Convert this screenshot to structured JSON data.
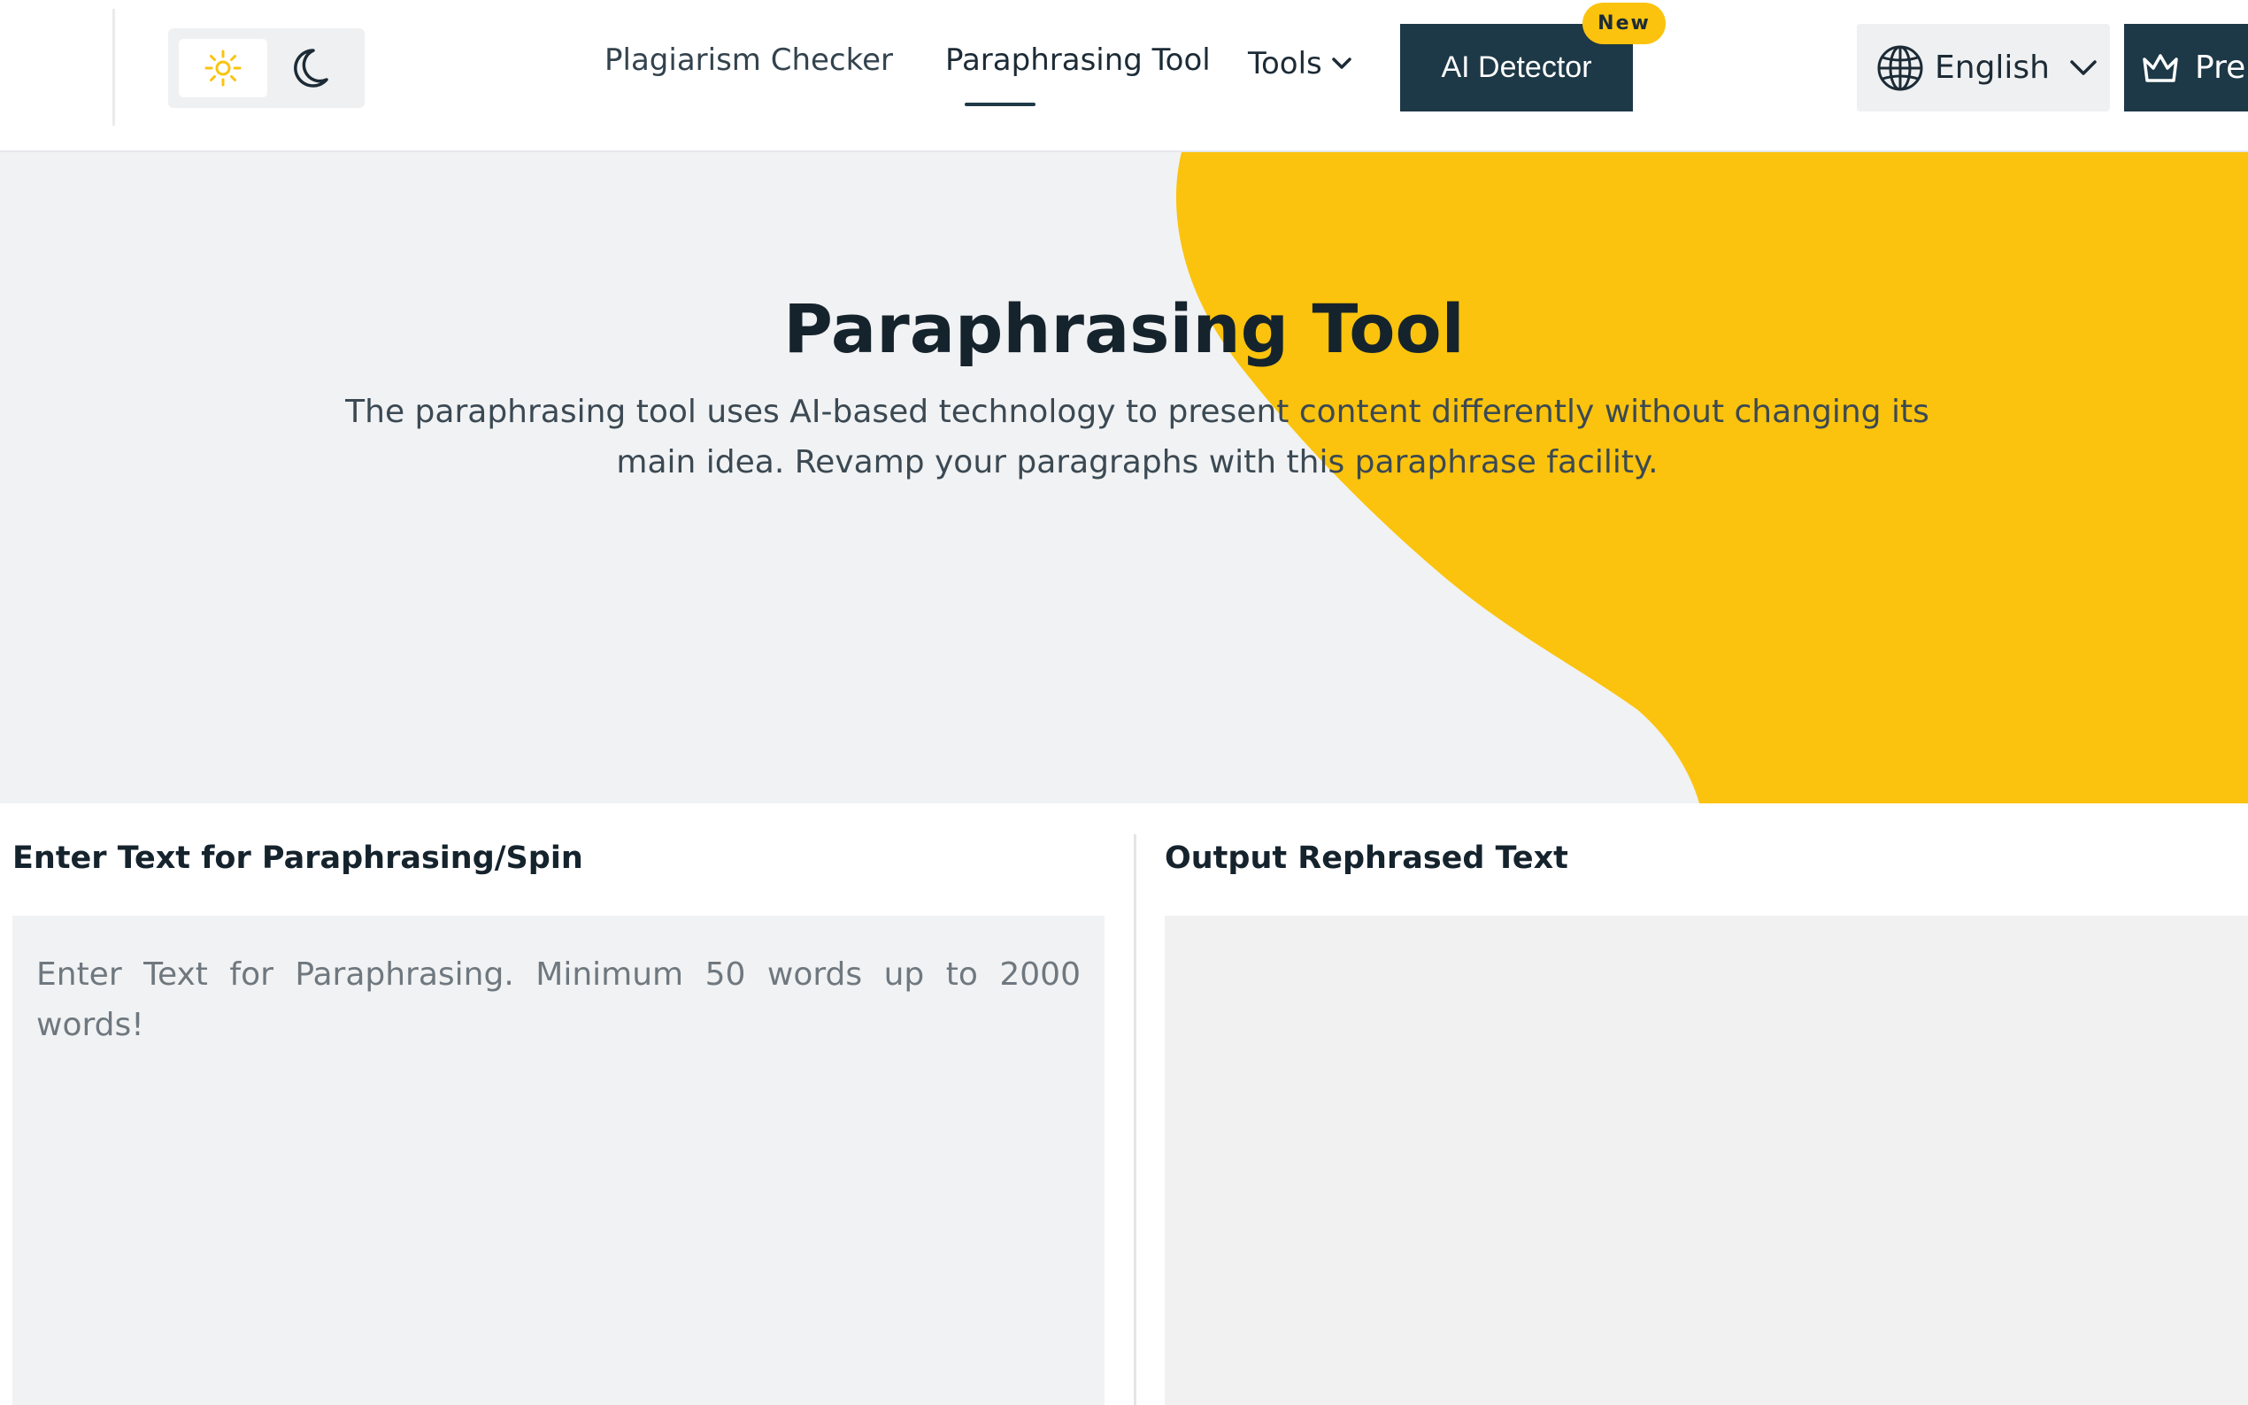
{
  "header": {
    "nav": [
      {
        "label": "Plagiarism Checker"
      },
      {
        "label": "Paraphrasing Tool"
      },
      {
        "label": "Tools"
      }
    ],
    "ai_detector_label": "AI Detector",
    "new_badge": "New",
    "language": "English",
    "premium_label": "Pre"
  },
  "hero": {
    "title": "Paraphrasing Tool",
    "subtitle": "The paraphrasing tool uses AI-based technology to present content differently without changing its main idea. Revamp your paragraphs with this paraphrase facility."
  },
  "input_panel": {
    "label": "Enter Text for Paraphrasing/Spin",
    "placeholder": "Enter Text for Paraphrasing. Minimum 50 words up to 2000 words!"
  },
  "output_panel": {
    "label": "Output Rephrased Text"
  },
  "colors": {
    "accent_yellow": "#fbc30d",
    "primary_dark": "#1d3846",
    "hero_background": "#f1f2f3"
  },
  "icons": [
    "sun-icon",
    "moon-icon",
    "chevron-down-icon",
    "globe-icon",
    "crown-icon"
  ]
}
